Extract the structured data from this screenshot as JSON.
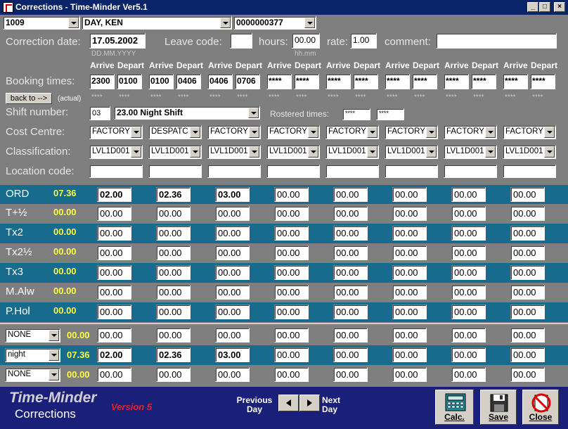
{
  "window": {
    "title": "Corrections - Time-Minder Ver5.1"
  },
  "top": {
    "employee_code": "1009",
    "employee_name": "DAY, KEN",
    "card_number": "0000000377"
  },
  "correction": {
    "date_label": "Correction date:",
    "date": "17.05.2002",
    "date_hint": "DD.MM.YYYY",
    "leave_label": "Leave code:",
    "leave_code": "",
    "hours_label": "hours:",
    "hours": "00.00",
    "hours_hint": "hh.mm",
    "rate_label": "rate:",
    "rate": "1.00",
    "comment_label": "comment:",
    "comment": ""
  },
  "booking": {
    "label": "Booking times:",
    "arrive_header": "Arrive",
    "depart_header": "Depart",
    "times": [
      "2300",
      "0100",
      "0100",
      "0406",
      "0406",
      "0706",
      "****",
      "****",
      "****",
      "****",
      "****",
      "****",
      "****",
      "****",
      "****",
      "****"
    ],
    "back_button": "back to -->",
    "actual_label": "(actual)",
    "actual_placeholder": "****"
  },
  "shift": {
    "label": "Shift number:",
    "number": "03",
    "name": "23.00 Night Shift",
    "rostered_label": "Rostered times:",
    "rostered_from": "****",
    "rostered_to": "****"
  },
  "cost_centre": {
    "label": "Cost Centre:",
    "values": [
      "FACTORY",
      "DESPATC",
      "FACTORY",
      "FACTORY",
      "FACTORY",
      "FACTORY",
      "FACTORY",
      "FACTORY"
    ]
  },
  "classification": {
    "label": "Classification:",
    "values": [
      "LVL1D001",
      "LVL1D001",
      "LVL1D001",
      "LVL1D001",
      "LVL1D001",
      "LVL1D001",
      "LVL1D001",
      "LVL1D001"
    ]
  },
  "location": {
    "label": "Location code:",
    "values": [
      "",
      "",
      "",
      "",
      "",
      "",
      "",
      ""
    ]
  },
  "hours_rows": [
    {
      "label": "ORD",
      "total": "07.36",
      "values": [
        "02.00",
        "02.36",
        "03.00",
        "00.00",
        "00.00",
        "00.00",
        "00.00",
        "00.00"
      ]
    },
    {
      "label": "T+½",
      "total": "00.00",
      "values": [
        "00.00",
        "00.00",
        "00.00",
        "00.00",
        "00.00",
        "00.00",
        "00.00",
        "00.00"
      ]
    },
    {
      "label": "Tx2",
      "total": "00.00",
      "values": [
        "00.00",
        "00.00",
        "00.00",
        "00.00",
        "00.00",
        "00.00",
        "00.00",
        "00.00"
      ]
    },
    {
      "label": "Tx2½",
      "total": "00.00",
      "values": [
        "00.00",
        "00.00",
        "00.00",
        "00.00",
        "00.00",
        "00.00",
        "00.00",
        "00.00"
      ]
    },
    {
      "label": "Tx3",
      "total": "00.00",
      "values": [
        "00.00",
        "00.00",
        "00.00",
        "00.00",
        "00.00",
        "00.00",
        "00.00",
        "00.00"
      ]
    },
    {
      "label": "M.Alw",
      "total": "00.00",
      "values": [
        "00.00",
        "00.00",
        "00.00",
        "00.00",
        "00.00",
        "00.00",
        "00.00",
        "00.00"
      ]
    },
    {
      "label": "P.Hol",
      "total": "00.00",
      "values": [
        "00.00",
        "00.00",
        "00.00",
        "00.00",
        "00.00",
        "00.00",
        "00.00",
        "00.00"
      ]
    }
  ],
  "extra_rows": [
    {
      "select": "NONE",
      "total": "00.00",
      "values": [
        "00.00",
        "00.00",
        "00.00",
        "00.00",
        "00.00",
        "00.00",
        "00.00",
        "00.00"
      ]
    },
    {
      "select": "night",
      "total": "07.36",
      "values": [
        "02.00",
        "02.36",
        "03.00",
        "00.00",
        "00.00",
        "00.00",
        "00.00",
        "00.00"
      ]
    },
    {
      "select": "NONE",
      "total": "00.00",
      "values": [
        "00.00",
        "00.00",
        "00.00",
        "00.00",
        "00.00",
        "00.00",
        "00.00",
        "00.00"
      ]
    }
  ],
  "footer": {
    "brand": "Time-Minder",
    "subtitle": "Corrections",
    "version": "Version 5",
    "prev_line1": "Previous",
    "prev_line2": "Day",
    "next_line1": "Next",
    "next_line2": "Day",
    "calc_label": "Calc.",
    "save_label": "Save",
    "close_label": "Close"
  },
  "colors": {
    "titlebar": "#0a246a",
    "panel": "#7f7f7f",
    "teal_band": "#176b8c",
    "footer": "#1a1f7a",
    "totals": "#ffff40",
    "version": "#e8202a"
  }
}
